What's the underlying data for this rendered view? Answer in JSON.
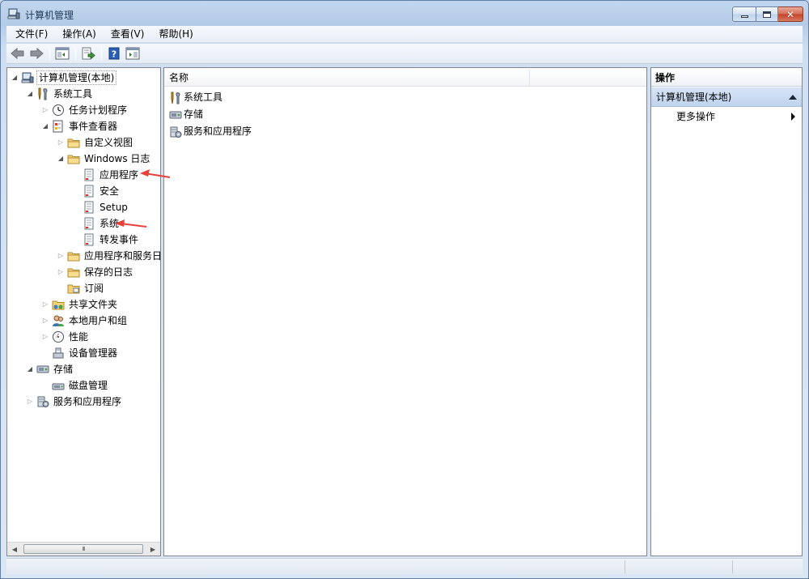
{
  "window": {
    "title": "计算机管理"
  },
  "menu": [
    {
      "label": "文件(F)"
    },
    {
      "label": "操作(A)"
    },
    {
      "label": "查看(V)"
    },
    {
      "label": "帮助(H)"
    }
  ],
  "toolbar": [
    {
      "icon": "back-arrow-icon"
    },
    {
      "icon": "forward-arrow-icon"
    },
    {
      "icon": "show-hide-console-tree-icon"
    },
    {
      "icon": "export-list-icon"
    },
    {
      "icon": "help-icon"
    },
    {
      "icon": "show-hide-action-pane-icon"
    }
  ],
  "tree": {
    "items": [
      {
        "label": "计算机管理(本地)",
        "level": 0,
        "expanded": true,
        "selected": true
      },
      {
        "label": "系统工具",
        "level": 1,
        "expanded": true
      },
      {
        "label": "任务计划程序",
        "level": 2,
        "expanded": false
      },
      {
        "label": "事件查看器",
        "level": 2,
        "expanded": true
      },
      {
        "label": "自定义视图",
        "level": 3,
        "expanded": false
      },
      {
        "label": "Windows 日志",
        "level": 3,
        "expanded": true
      },
      {
        "label": "应用程序",
        "level": 4
      },
      {
        "label": "安全",
        "level": 4
      },
      {
        "label": "Setup",
        "level": 4
      },
      {
        "label": "系统",
        "level": 4
      },
      {
        "label": "转发事件",
        "level": 4
      },
      {
        "label": "应用程序和服务日志",
        "level": 3,
        "expanded": false
      },
      {
        "label": "保存的日志",
        "level": 3,
        "expanded": false
      },
      {
        "label": "订阅",
        "level": 3
      },
      {
        "label": "共享文件夹",
        "level": 2,
        "expanded": false
      },
      {
        "label": "本地用户和组",
        "level": 2,
        "expanded": false
      },
      {
        "label": "性能",
        "level": 2,
        "expanded": false
      },
      {
        "label": "设备管理器",
        "level": 2
      },
      {
        "label": "存储",
        "level": 1,
        "expanded": true
      },
      {
        "label": "磁盘管理",
        "level": 2
      },
      {
        "label": "服务和应用程序",
        "level": 1,
        "expanded": false
      }
    ],
    "scrollbar_thumb_label": "III"
  },
  "list": {
    "column_name": "名称",
    "rows": [
      {
        "label": "系统工具"
      },
      {
        "label": "存储"
      },
      {
        "label": "服务和应用程序"
      }
    ]
  },
  "actions": {
    "header": "操作",
    "section": "计算机管理(本地)",
    "items": [
      {
        "label": "更多操作"
      }
    ]
  },
  "colors": {
    "annotation_arrow": "#e8403a",
    "section_bg": "#c8daf2",
    "close_button": "#c7432c"
  }
}
